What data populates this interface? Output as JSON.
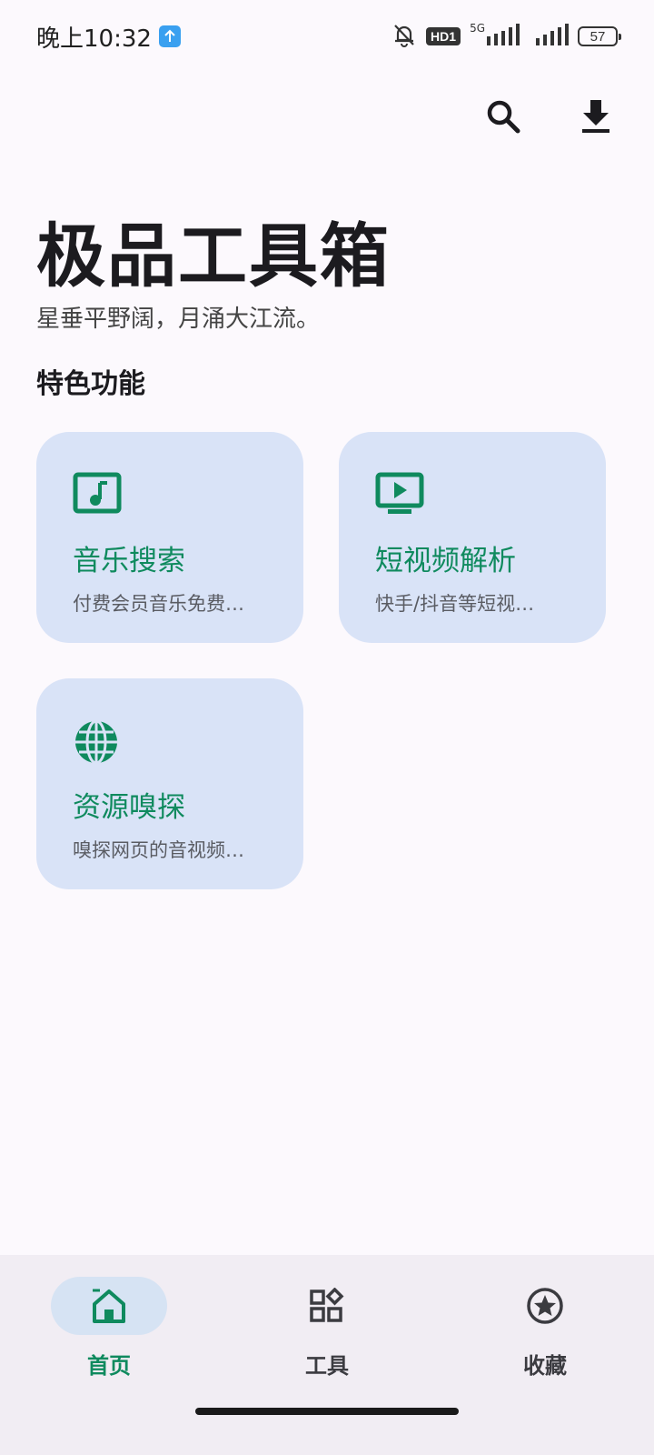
{
  "status_bar": {
    "time": "晚上10:32",
    "hd_label": "HD1",
    "network_label": "5G",
    "battery": "57"
  },
  "header": {
    "search_icon": "search-icon",
    "download_icon": "download-icon"
  },
  "app": {
    "title": "极品工具箱",
    "subtitle": "星垂平野阔，月涌大江流。"
  },
  "features": {
    "section_title": "特色功能",
    "cards": [
      {
        "icon": "music-note-icon",
        "title": "音乐搜索",
        "desc": "付费会员音乐免费…"
      },
      {
        "icon": "video-play-icon",
        "title": "短视频解析",
        "desc": "快手/抖音等短视…"
      },
      {
        "icon": "globe-icon",
        "title": "资源嗅探",
        "desc": "嗅探网页的音视频…"
      }
    ]
  },
  "bottom_nav": {
    "items": [
      {
        "label": "首页",
        "icon": "home-icon",
        "active": true
      },
      {
        "label": "工具",
        "icon": "widgets-icon",
        "active": false
      },
      {
        "label": "收藏",
        "icon": "star-icon",
        "active": false
      }
    ]
  },
  "colors": {
    "accent": "#0f8a5e",
    "card_bg": "#d9e3f7",
    "background": "#fcf9fd",
    "nav_bg": "#f1edf3"
  }
}
